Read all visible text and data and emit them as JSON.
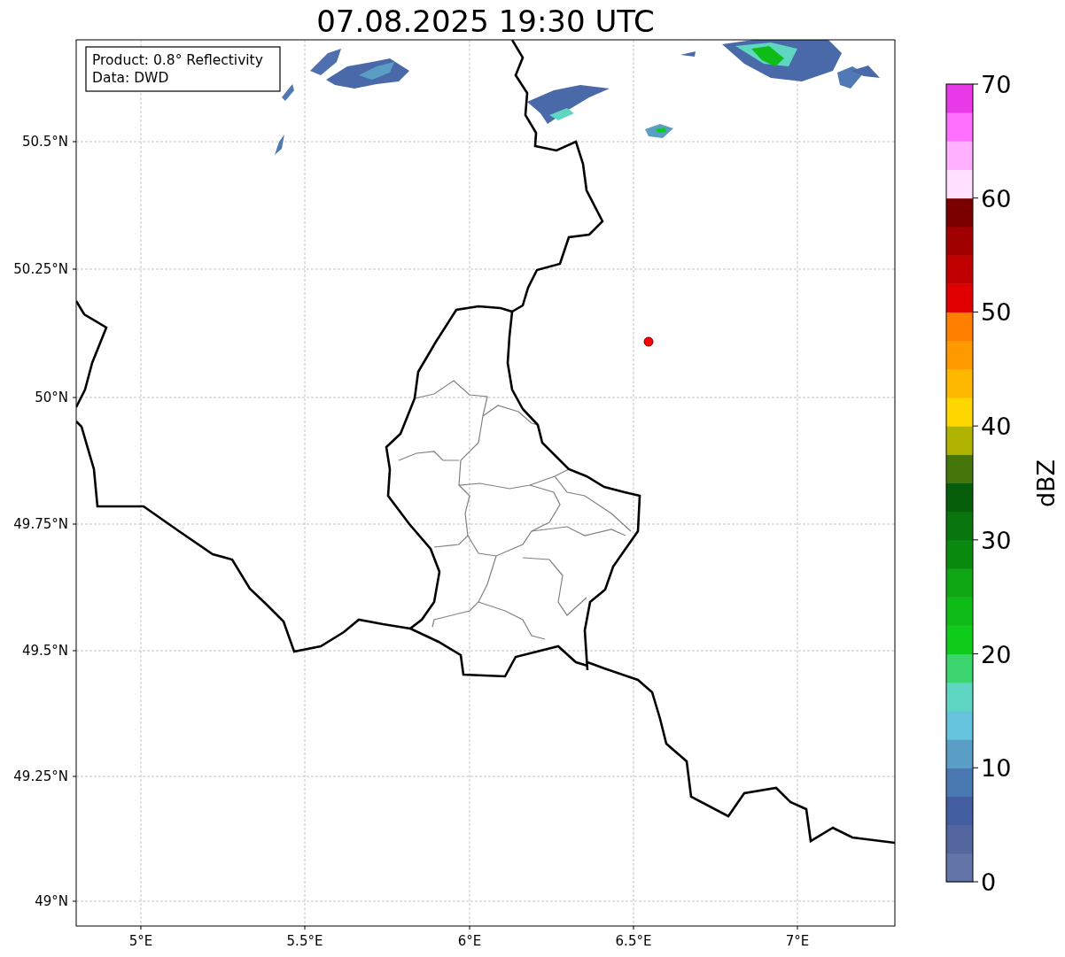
{
  "title": "07.08.2025 19:30 UTC",
  "annotation": [
    "Product: 0.8° Reflectivity",
    "Data: DWD"
  ],
  "lat_ticks": [
    "50.5°N",
    "50.25°N",
    "50°N",
    "49.75°N",
    "49.5°N",
    "49.25°N",
    "49°N"
  ],
  "lon_ticks": [
    "5°E",
    "5.5°E",
    "6°E",
    "6.5°E",
    "7°E"
  ],
  "colorbar": {
    "label": "dBZ",
    "ticks": [
      "70",
      "60",
      "50",
      "40",
      "30",
      "20",
      "10",
      "0"
    ],
    "bins": [
      {
        "color": "#6374a6"
      },
      {
        "color": "#53679e"
      },
      {
        "color": "#425ea0"
      },
      {
        "color": "#4a78b0"
      },
      {
        "color": "#5a9ec6"
      },
      {
        "color": "#66c3dc"
      },
      {
        "color": "#5fd6c2"
      },
      {
        "color": "#3cd46e"
      },
      {
        "color": "#10cc1a"
      },
      {
        "color": "#0fbb17"
      },
      {
        "color": "#0ea612"
      },
      {
        "color": "#0b8a10"
      },
      {
        "color": "#09750e"
      },
      {
        "color": "#065e0b"
      },
      {
        "color": "#46760b"
      },
      {
        "color": "#b0b300"
      },
      {
        "color": "#ffd700"
      },
      {
        "color": "#ffb800"
      },
      {
        "color": "#ff9900"
      },
      {
        "color": "#ff7f00"
      },
      {
        "color": "#e00000"
      },
      {
        "color": "#c00000"
      },
      {
        "color": "#a00000"
      },
      {
        "color": "#7a0000"
      },
      {
        "color": "#ffe0ff"
      },
      {
        "color": "#ffb0ff"
      },
      {
        "color": "#ff70ff"
      },
      {
        "color": "#e83ae8"
      }
    ]
  }
}
